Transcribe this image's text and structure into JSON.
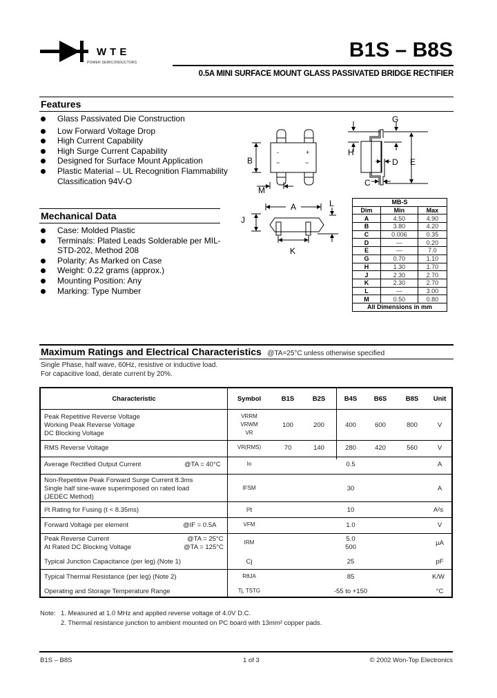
{
  "header": {
    "brand": "WTE",
    "brand_tagline": "POWER SEMICONDUCTORS",
    "part_range": "B1S – B8S",
    "subtitle": "0.5A MINI SURFACE MOUNT GLASS PASSIVATED BRIDGE RECTIFIER"
  },
  "features": {
    "title": "Features",
    "items": [
      "Glass Passivated Die Construction",
      "Low Forward Voltage Drop",
      "High Current Capability",
      "High Surge Current Capability",
      "Designed for Surface Mount Application",
      "Plastic Material – UL Recognition Flammability Classification 94V-O"
    ]
  },
  "mechanical": {
    "title": "Mechanical Data",
    "items": [
      "Case: Molded Plastic",
      "Terminals: Plated Leads Solderable per MIL-STD-202, Method 208",
      "Polarity: As Marked on Case",
      "Weight: 0.22 grams (approx.)",
      "Mounting Position: Any",
      "Marking: Type Number"
    ]
  },
  "diagram": {
    "labels": {
      "A": "A",
      "B": "B",
      "C": "C",
      "D": "D",
      "E": "E",
      "G": "G",
      "H": "H",
      "J": "J",
      "K": "K",
      "L": "L",
      "M": "M"
    },
    "pin_minus": "-",
    "pin_plus": "+",
    "pin_ac1": "~",
    "pin_ac2": "~"
  },
  "dimensions": {
    "package": "MB-S",
    "headers": [
      "Dim",
      "Min",
      "Max"
    ],
    "rows": [
      [
        "A",
        "4.50",
        "4.90"
      ],
      [
        "B",
        "3.80",
        "4.20"
      ],
      [
        "C",
        "0.006",
        "0.35"
      ],
      [
        "D",
        "—",
        "0.20"
      ],
      [
        "E",
        "—",
        "7.0"
      ],
      [
        "G",
        "0.70",
        "1.10"
      ],
      [
        "H",
        "1.30",
        "1.70"
      ],
      [
        "J",
        "2.30",
        "2.70"
      ],
      [
        "K",
        "2.30",
        "2.70"
      ],
      [
        "L",
        "—",
        "3.00"
      ],
      [
        "M",
        "0.50",
        "0.80"
      ]
    ],
    "footer": "All Dimensions in mm"
  },
  "ratings": {
    "title": "Maximum Ratings and Electrical Characteristics",
    "condition": "@TA=25°C unless otherwise specified",
    "note_line1": "Single Phase, half wave, 60Hz, resistive or inductive load.",
    "note_line2": "For capacitive load, derate current by 20%.",
    "table": {
      "headers": {
        "characteristic": "Characteristic",
        "symbol": "Symbol",
        "b1s": "B1S",
        "b2s": "B2S",
        "b4s": "B4S",
        "b6s": "B6S",
        "b8s": "B8S",
        "unit": "Unit"
      },
      "rows": {
        "vrrm": {
          "char1": "Peak Repetitive Reverse Voltage",
          "char2": "Working Peak Reverse Voltage",
          "char3": "DC Blocking Voltage",
          "sym1": "VRRM",
          "sym2": "VRWM",
          "sym3": "VR",
          "b1s": "100",
          "b2s": "200",
          "b4s": "400",
          "b6s": "600",
          "b8s": "800",
          "unit": "V"
        },
        "vrms": {
          "char": "RMS Reverse Voltage",
          "sym": "VR(RMS)",
          "b1s": "70",
          "b2s": "140",
          "b4s": "280",
          "b6s": "420",
          "b8s": "560",
          "unit": "V"
        },
        "io": {
          "char": "Average Rectified Output Current",
          "cond": "@TA = 40°C",
          "sym": "Io",
          "value": "0.5",
          "unit": "A"
        },
        "ifsm": {
          "char1": "Non-Repetitive Peak Forward Surge Current 8.3ms",
          "char2": "Single half sine-wave superimposed on rated load",
          "char3": "(JEDEC Method)",
          "sym": "IFSM",
          "value": "30",
          "unit": "A"
        },
        "i2t": {
          "char": "I²t Rating for Fusing (t < 8.35ms)",
          "sym": "I²t",
          "value": "10",
          "unit": "A²s"
        },
        "vfm": {
          "char": "Forward Voltage per element",
          "cond": "@IF = 0.5A",
          "sym": "VFM",
          "value": "1.0",
          "unit": "V"
        },
        "irm": {
          "char1": "Peak Reverse Current",
          "cond1": "@TA = 25°C",
          "char2": "At Rated DC Blocking Voltage",
          "cond2": "@TA = 125°C",
          "sym": "IRM",
          "value1": "5.0",
          "value2": "500",
          "unit": "µA"
        },
        "cj": {
          "char": "Typical Junction Capacitance (per leg) (Note 1)",
          "sym": "Cj",
          "value": "25",
          "unit": "pF"
        },
        "rth": {
          "char": "Typical Thermal Resistance (per leg) (Note 2)",
          "sym": "RθJA",
          "value": "85",
          "unit": "K/W"
        },
        "temp": {
          "char": "Operating and Storage Temperature Range",
          "sym": "Tj, TSTG",
          "value": "-55 to +150",
          "unit": "°C"
        }
      }
    }
  },
  "notes": {
    "label": "Note:",
    "items": [
      "1. Measured at 1.0 MHz and applied reverse voltage of 4.0V D.C.",
      "2. Thermal resistance junction to ambient mounted on PC board with 13mm² copper pads."
    ]
  },
  "footer": {
    "left": "B1S – B8S",
    "center": "1 of 3",
    "right": "© 2002 Won-Top Electronics"
  }
}
